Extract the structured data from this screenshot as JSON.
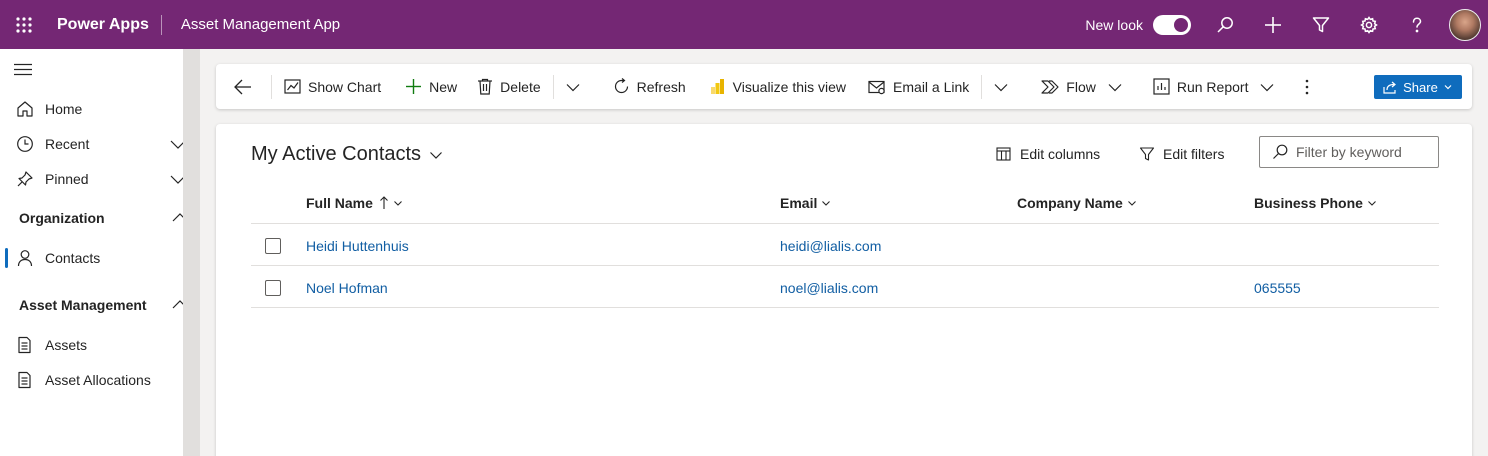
{
  "header": {
    "brand": "Power Apps",
    "app_name": "Asset Management App",
    "new_look_label": "New look",
    "new_look_on": true
  },
  "sidebar": {
    "home": "Home",
    "recent": "Recent",
    "pinned": "Pinned",
    "group_org": "Organization",
    "contacts": "Contacts",
    "group_asset": "Asset Management",
    "assets": "Assets",
    "asset_allocations": "Asset Allocations"
  },
  "commandbar": {
    "show_chart": "Show Chart",
    "new": "New",
    "delete": "Delete",
    "refresh": "Refresh",
    "visualize": "Visualize this view",
    "email_link": "Email a Link",
    "flow": "Flow",
    "run_report": "Run Report",
    "share": "Share"
  },
  "view": {
    "title": "My Active Contacts",
    "edit_columns": "Edit columns",
    "edit_filters": "Edit filters",
    "filter_placeholder": "Filter by keyword"
  },
  "grid": {
    "columns": [
      "Full Name",
      "Email",
      "Company Name",
      "Business Phone"
    ],
    "rows": [
      {
        "full_name": "Heidi Huttenhuis",
        "email": "heidi@lialis.com",
        "company": "",
        "phone": ""
      },
      {
        "full_name": "Noel Hofman",
        "email": "noel@lialis.com",
        "company": "",
        "phone": "065555"
      }
    ]
  },
  "colors": {
    "topbar": "#742774",
    "accent": "#0f6cbd",
    "link": "#115ea3"
  }
}
